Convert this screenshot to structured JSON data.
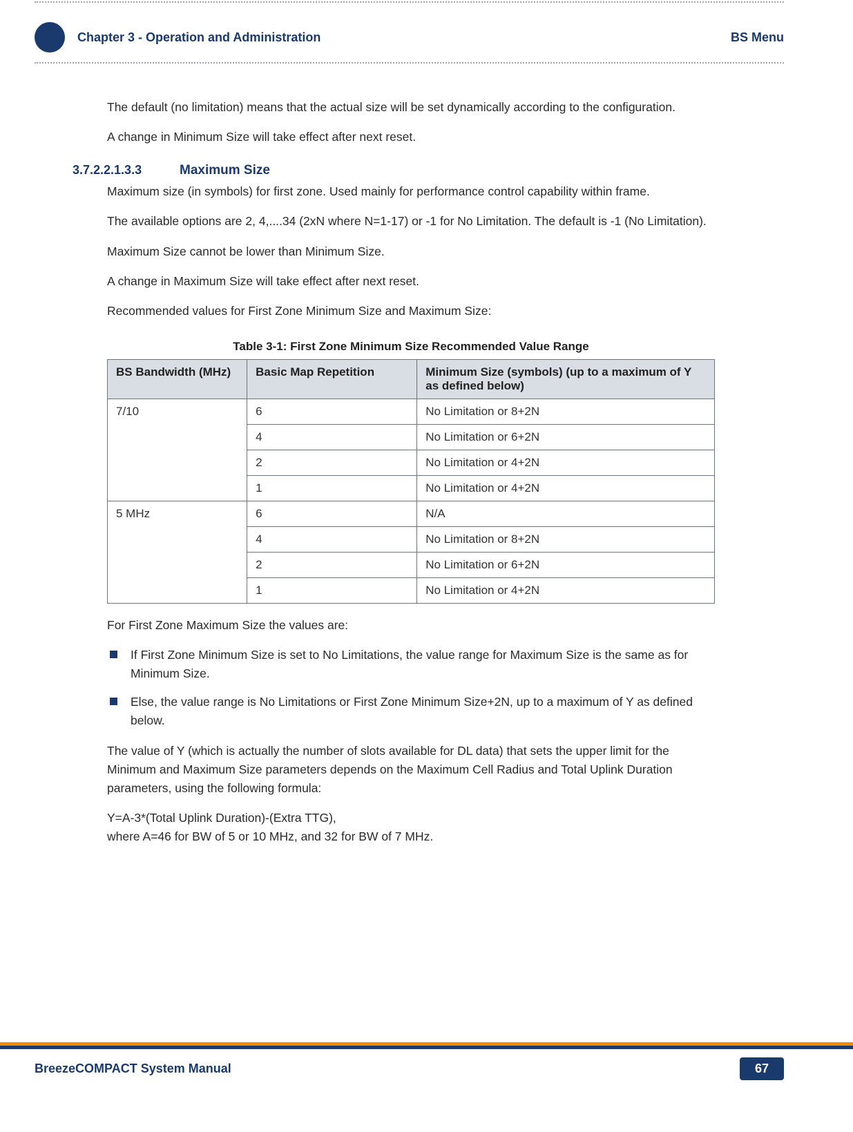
{
  "header": {
    "chapter_label": "Chapter 3 - Operation and Administration",
    "right_label": "BS Menu"
  },
  "intro": {
    "p1": "The default (no limitation) means that the actual size will be set dynamically according to the configuration.",
    "p2": "A change in Minimum Size will take effect after next reset."
  },
  "section": {
    "number": "3.7.2.2.1.3.3",
    "title": "Maximum Size",
    "p1": "Maximum size (in symbols) for first zone. Used mainly for performance control capability within frame.",
    "p2": "The available options are 2, 4,....34 (2xN where N=1-17) or -1 for No Limitation. The default is -1 (No Limitation).",
    "p3": "Maximum Size cannot be lower than Minimum Size.",
    "p4": "A change in Maximum Size will take effect after next reset.",
    "p5": "Recommended values for First Zone Minimum Size and Maximum Size:"
  },
  "table": {
    "caption": "Table 3-1: First Zone Minimum Size Recommended Value Range",
    "headers": {
      "c1": "BS Bandwidth (MHz)",
      "c2": "Basic Map Repetition",
      "c3": "Minimum Size (symbols) (up to a maximum of Y as defined below)"
    },
    "groups": [
      {
        "bw": "7/10",
        "rows": [
          {
            "rep": "6",
            "min": "No Limitation or 8+2N"
          },
          {
            "rep": "4",
            "min": "No Limitation or 6+2N"
          },
          {
            "rep": "2",
            "min": "No Limitation or 4+2N"
          },
          {
            "rep": "1",
            "min": "No Limitation or 4+2N"
          }
        ]
      },
      {
        "bw": "5 MHz",
        "rows": [
          {
            "rep": "6",
            "min": "N/A"
          },
          {
            "rep": "4",
            "min": "No Limitation or 8+2N"
          },
          {
            "rep": "2",
            "min": "No Limitation or 6+2N"
          },
          {
            "rep": "1",
            "min": "No Limitation or 4+2N"
          }
        ]
      }
    ]
  },
  "after_table": {
    "p1": "For First Zone Maximum Size the values are:",
    "bullets": [
      "If First Zone Minimum Size is set to No Limitations, the value range for Maximum Size is the same as for Minimum Size.",
      "Else, the value range is No Limitations or First Zone Minimum Size+2N, up to a maximum of Y as defined below."
    ],
    "p2": "The value of Y (which is actually the number of slots available for DL data) that sets the upper limit for the Minimum and Maximum Size parameters depends on the Maximum Cell Radius and Total Uplink Duration parameters, using the following formula:",
    "p3a": "Y=A-3*(Total Uplink Duration)-(Extra TTG),",
    "p3b": "where A=46 for BW of 5 or 10 MHz, and 32 for BW of 7 MHz."
  },
  "footer": {
    "manual_title": "BreezeCOMPACT System Manual",
    "page_number": "67"
  }
}
